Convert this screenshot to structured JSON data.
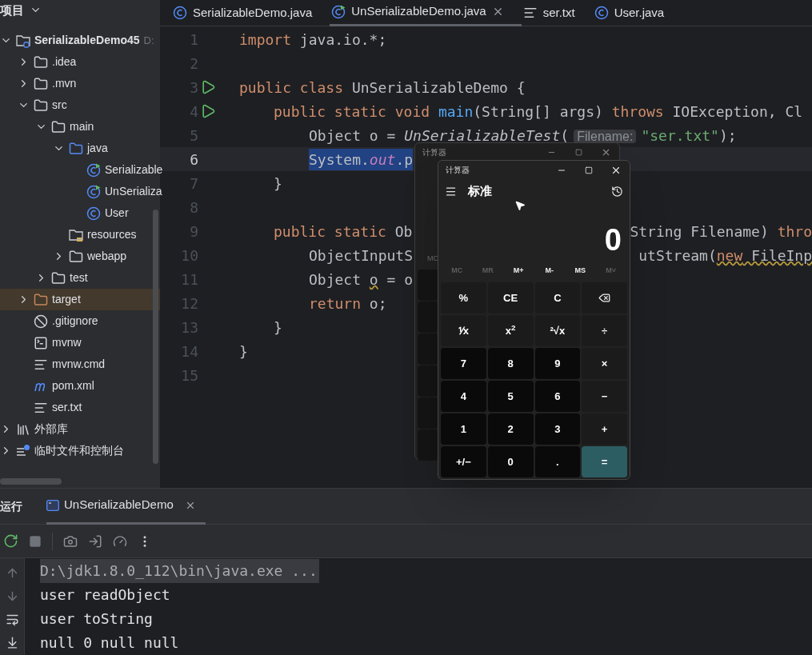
{
  "project_panel": {
    "title": "项目",
    "tree": [
      {
        "label": "SerializableDemo45",
        "hint": "D:",
        "kind": "project",
        "expanded": true,
        "selected": false,
        "children": [
          {
            "label": ".idea",
            "kind": "folder",
            "expanded": false,
            "selected": false
          },
          {
            "label": ".mvn",
            "kind": "folder",
            "expanded": false,
            "selected": false
          },
          {
            "label": "src",
            "kind": "folder",
            "expanded": true,
            "selected": false,
            "children": [
              {
                "label": "main",
                "kind": "folder",
                "expanded": true,
                "selected": false,
                "children": [
                  {
                    "label": "java",
                    "kind": "source",
                    "expanded": true,
                    "selected": false,
                    "children": [
                      {
                        "label": "Serializable",
                        "kind": "runnable",
                        "selected": false
                      },
                      {
                        "label": "UnSerializa",
                        "kind": "runnable",
                        "selected": false
                      },
                      {
                        "label": "User",
                        "kind": "class",
                        "selected": false
                      }
                    ]
                  },
                  {
                    "label": "resources",
                    "kind": "resources",
                    "selected": false
                  },
                  {
                    "label": "webapp",
                    "kind": "folder",
                    "expanded": false,
                    "selected": false
                  }
                ]
              },
              {
                "label": "test",
                "kind": "folder",
                "expanded": false,
                "selected": false
              }
            ]
          },
          {
            "label": "target",
            "kind": "excluded",
            "expanded": false,
            "selected": true
          },
          {
            "label": ".gitignore",
            "kind": "ignore",
            "selected": false
          },
          {
            "label": "mvnw",
            "kind": "terminal",
            "selected": false
          },
          {
            "label": "mvnw.cmd",
            "kind": "text",
            "selected": false
          },
          {
            "label": "pom.xml",
            "kind": "maven",
            "selected": false
          },
          {
            "label": "ser.txt",
            "kind": "text",
            "selected": false
          }
        ]
      },
      {
        "label": "外部库",
        "kind": "library",
        "expanded": false,
        "selected": false
      },
      {
        "label": "临时文件和控制台",
        "kind": "scratch",
        "expanded": false,
        "selected": false
      }
    ]
  },
  "editor": {
    "tabs": [
      {
        "label": "SerializableDemo.java",
        "kind": "class",
        "selected": false
      },
      {
        "label": "UnSerializableDemo.java",
        "kind": "runnable",
        "selected": true
      },
      {
        "label": "ser.txt",
        "kind": "text",
        "selected": false
      },
      {
        "label": "User.java",
        "kind": "class",
        "selected": false
      }
    ],
    "lines": [
      {
        "number": "1",
        "kind": "top",
        "run": false,
        "current": false,
        "selected": false,
        "tokens": [
          {
            "text": "import",
            "kind": "kw"
          },
          {
            "text": " java.io.*;",
            "kind": "plain"
          }
        ]
      },
      {
        "number": "2",
        "kind": "top",
        "run": false,
        "current": false,
        "selected": false
      },
      {
        "number": "3",
        "kind": "top",
        "run": true,
        "current": false,
        "selected": false,
        "tokens": [
          {
            "text": "public class ",
            "kind": "kw"
          },
          {
            "text": "UnSerializableDemo {",
            "kind": "plain"
          }
        ]
      },
      {
        "number": "4",
        "kind": "member",
        "run": true,
        "current": false,
        "selected": false,
        "tokens": [
          {
            "text": "public static void ",
            "kind": "kw"
          },
          {
            "text": "main",
            "kind": "method"
          },
          {
            "text": "(String[] args) ",
            "kind": "plain"
          },
          {
            "text": "throws",
            "kind": "kw"
          },
          {
            "text": " IOException, Cl",
            "kind": "plain"
          }
        ]
      },
      {
        "number": "5",
        "kind": "statement",
        "run": false,
        "current": false,
        "selected": false,
        "tokens": [
          {
            "text": "Object o = ",
            "kind": "plain"
          },
          {
            "text": "UnSerializableTest",
            "kind": "italic"
          },
          {
            "text": "(",
            "kind": "plain"
          },
          {
            "text": "Filename:",
            "kind": "hint"
          },
          {
            "text": "\"ser.txt\"",
            "kind": "string"
          },
          {
            "text": ");",
            "kind": "plain"
          }
        ]
      },
      {
        "number": "6",
        "kind": "statement",
        "run": false,
        "current": true,
        "selected": true,
        "tokens": [
          {
            "text": "System.",
            "kind": "plain"
          },
          {
            "text": "out",
            "kind": "field"
          },
          {
            "text": ".p",
            "kind": "plain"
          }
        ]
      },
      {
        "number": "7",
        "kind": "member",
        "run": false,
        "current": false,
        "selected": false,
        "tokens": [
          {
            "text": "}",
            "kind": "plain"
          }
        ]
      },
      {
        "number": "8",
        "kind": "top",
        "run": false,
        "current": false,
        "selected": false
      },
      {
        "number": "9",
        "kind": "member",
        "run": false,
        "current": false,
        "selected": false,
        "tokens": [
          {
            "text": "public static ",
            "kind": "kw"
          },
          {
            "text": "Ob",
            "kind": "plain"
          }
        ],
        "tokens_right": [
          {
            "text": "String Filename) ",
            "kind": "plain"
          },
          {
            "text": "thro",
            "kind": "kw"
          }
        ]
      },
      {
        "number": "10",
        "kind": "statement",
        "run": false,
        "current": false,
        "selected": false,
        "tokens": [
          {
            "text": "ObjectInputS",
            "kind": "plain"
          }
        ],
        "tokens_right": [
          {
            "text": "utStream(",
            "kind": "plain"
          },
          {
            "text": "new",
            "kind": "kw_warn"
          },
          {
            "text": " FileInp",
            "kind": "plain_warn"
          }
        ]
      },
      {
        "number": "11",
        "kind": "statement",
        "run": false,
        "current": false,
        "selected": false,
        "tokens": [
          {
            "text": "Object ",
            "kind": "plain"
          },
          {
            "text": "o",
            "kind": "plain_warn"
          },
          {
            "text": " = o",
            "kind": "plain"
          }
        ]
      },
      {
        "number": "12",
        "kind": "statement",
        "run": false,
        "current": false,
        "selected": false,
        "tokens": [
          {
            "text": "return",
            "kind": "kw"
          },
          {
            "text": " o;",
            "kind": "plain"
          }
        ]
      },
      {
        "number": "13",
        "kind": "member",
        "run": false,
        "current": false,
        "selected": false,
        "tokens": [
          {
            "text": "}",
            "kind": "plain"
          }
        ]
      },
      {
        "number": "14",
        "kind": "top",
        "run": false,
        "current": false,
        "selected": false,
        "tokens": [
          {
            "text": "}",
            "kind": "plain"
          }
        ]
      },
      {
        "number": "15",
        "kind": "top",
        "run": false,
        "current": false,
        "selected": false
      }
    ]
  },
  "run_panel": {
    "title": "运行",
    "tabs": [
      {
        "label": "UnSerializableDemo",
        "selected": true
      }
    ],
    "console": [
      {
        "text": "D:\\jdk1.8.0_112\\bin\\java.exe ...",
        "kind": "command"
      },
      {
        "text": "user readObject",
        "kind": "output"
      },
      {
        "text": "user toString",
        "kind": "output"
      },
      {
        "text": "null 0 null null",
        "kind": "output"
      }
    ]
  },
  "calculator_back": {
    "title": "计算器",
    "memory_label": "MC"
  },
  "calculator": {
    "title": "计算器",
    "mode": "标准",
    "display": "0",
    "memory": [
      {
        "label": "MC",
        "disabled": true
      },
      {
        "label": "MR",
        "disabled": true
      },
      {
        "label": "M+",
        "disabled": false
      },
      {
        "label": "M-",
        "disabled": false
      },
      {
        "label": "MS",
        "disabled": false
      },
      {
        "label": "M˅",
        "disabled": true
      }
    ],
    "keys": [
      {
        "label": "%",
        "kind": "function"
      },
      {
        "label": "CE",
        "kind": "function"
      },
      {
        "label": "C",
        "kind": "function"
      },
      {
        "kind": "backspace"
      },
      {
        "label": "⅟x",
        "kind": "function"
      },
      {
        "label": "x$^{2}$",
        "kind": "function"
      },
      {
        "label": "²√x",
        "kind": "function"
      },
      {
        "label": "÷",
        "kind": "function"
      },
      {
        "label": "7",
        "kind": "digit"
      },
      {
        "label": "8",
        "kind": "digit"
      },
      {
        "label": "9",
        "kind": "digit"
      },
      {
        "label": "×",
        "kind": "function"
      },
      {
        "label": "4",
        "kind": "digit"
      },
      {
        "label": "5",
        "kind": "digit"
      },
      {
        "label": "6",
        "kind": "digit"
      },
      {
        "label": "−",
        "kind": "function"
      },
      {
        "label": "1",
        "kind": "digit"
      },
      {
        "label": "2",
        "kind": "digit"
      },
      {
        "label": "3",
        "kind": "digit"
      },
      {
        "label": "+",
        "kind": "function"
      },
      {
        "label": "+/−",
        "kind": "digit"
      },
      {
        "label": "0",
        "kind": "digit"
      },
      {
        "label": ".",
        "kind": "digit"
      },
      {
        "label": "=",
        "kind": "equals"
      }
    ]
  }
}
